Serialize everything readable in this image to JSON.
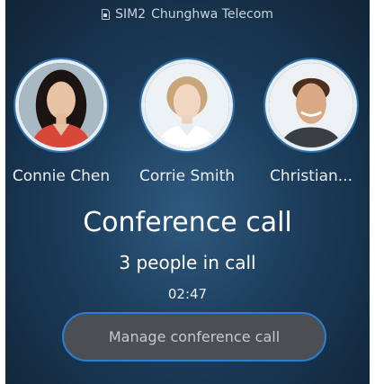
{
  "status_bar": {
    "sim_icon": "sim-card-icon",
    "sim_label": "SIM2",
    "carrier": "Chunghwa Telecom"
  },
  "participants": [
    {
      "name": "Connie Chen"
    },
    {
      "name": "Corrie Smith"
    },
    {
      "name": "Christian..."
    }
  ],
  "call": {
    "title": "Conference call",
    "subtitle": "3 people in call",
    "duration": "02:47"
  },
  "actions": {
    "manage_label": "Manage conference call"
  },
  "colors": {
    "accent": "#2a7fd0",
    "background": "#1c3c5a",
    "button": "#4b4f54"
  }
}
